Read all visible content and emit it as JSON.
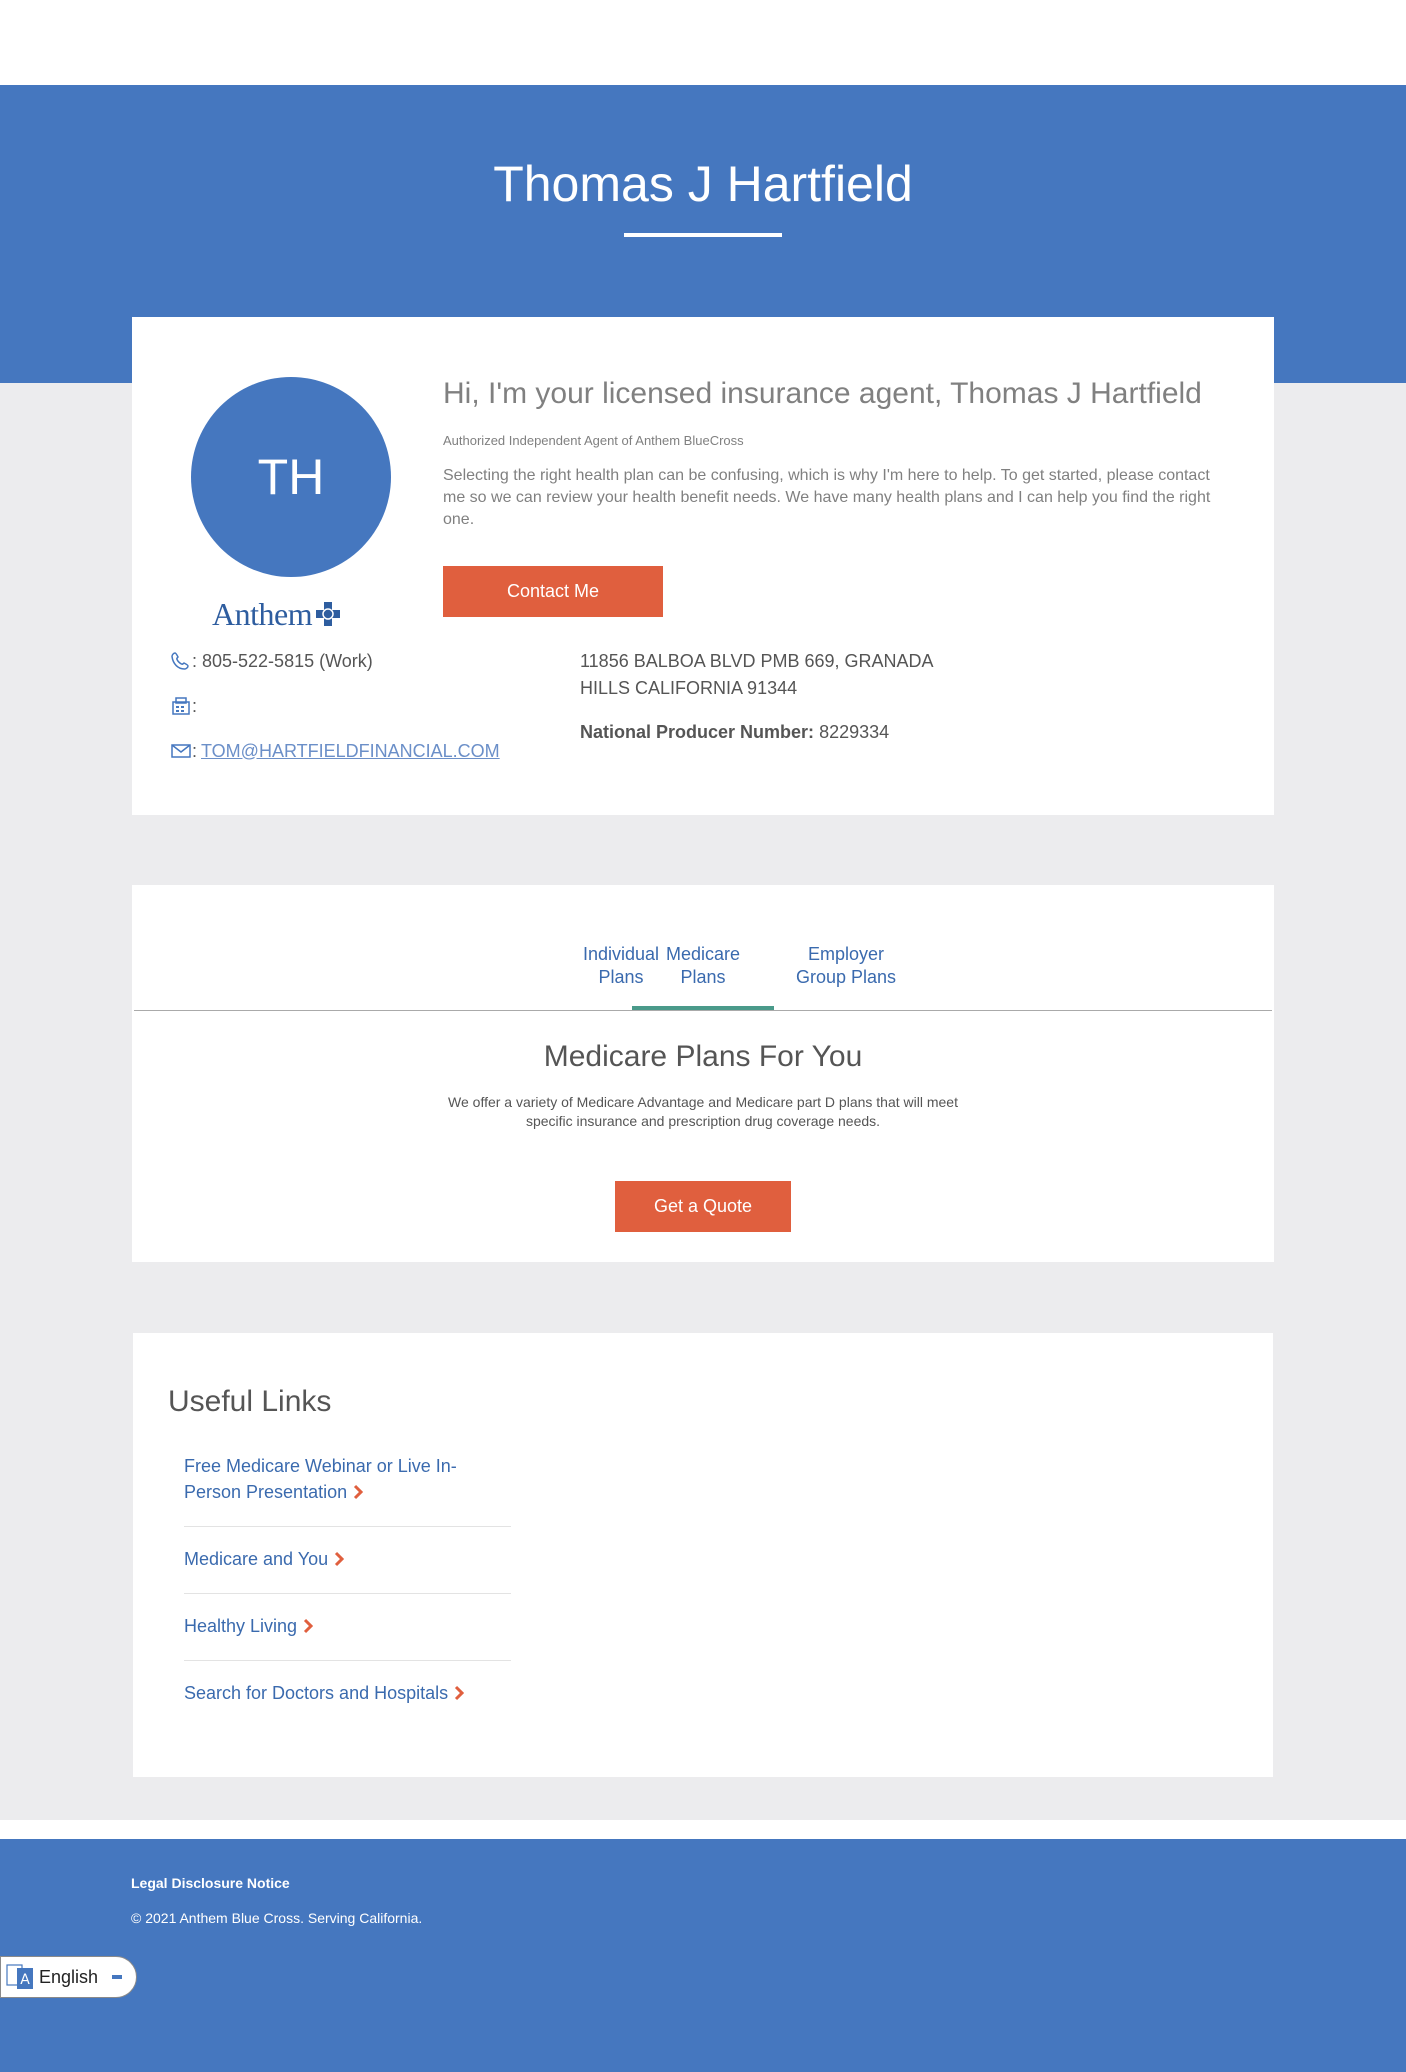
{
  "header": {
    "agent_name": "Thomas J Hartfield"
  },
  "profile": {
    "initials": "TH",
    "logo_text": "Anthem",
    "greeting": "Hi, I'm your licensed insurance agent, Thomas J Hartfield",
    "authorization": "Authorized Independent Agent of Anthem BlueCross",
    "intro": "Selecting the right health plan can be confusing, which is why I'm here to help. To get started, please contact me so we can review your health benefit needs. We have many health plans and I can help you find the right one.",
    "contact_button": "Contact Me",
    "phone": ": 805-522-5815 (Work)",
    "fax": ":",
    "email_prefix": ":",
    "email": "TOM@HARTFIELDFINANCIAL.COM",
    "address_line1": "11856 BALBOA BLVD PMB 669, GRANADA",
    "address_line2": "HILLS CALIFORNIA 91344",
    "npn_label": "National Producer Number:",
    "npn_value": "8229334"
  },
  "plans": {
    "tabs": [
      {
        "line1": "Individual",
        "line2": "Plans",
        "active": false
      },
      {
        "line1": "Medicare",
        "line2": "Plans",
        "active": true
      },
      {
        "line1": "Employer",
        "line2": "Group Plans",
        "active": false
      }
    ],
    "title": "Medicare Plans For You",
    "description": "We offer a variety of Medicare Advantage and Medicare part D plans that will meet specific insurance and prescription drug coverage needs.",
    "quote_button": "Get a Quote"
  },
  "useful_links": {
    "title": "Useful Links",
    "items": [
      {
        "line1": "Free Medicare Webinar or Live In-",
        "line2": "Person Presentation"
      },
      {
        "line1": "Medicare and You"
      },
      {
        "line1": "Healthy Living"
      },
      {
        "line1": "Search for Doctors and Hospitals"
      }
    ]
  },
  "footer": {
    "legal": "Legal Disclosure Notice",
    "copyright": "© 2021 Anthem Blue Cross. Serving California.",
    "language": "English"
  },
  "colors": {
    "brand_blue": "#4577bf",
    "accent_orange": "#e05f3e",
    "tab_active": "#4a9a8a",
    "background_gray": "#ececee"
  }
}
